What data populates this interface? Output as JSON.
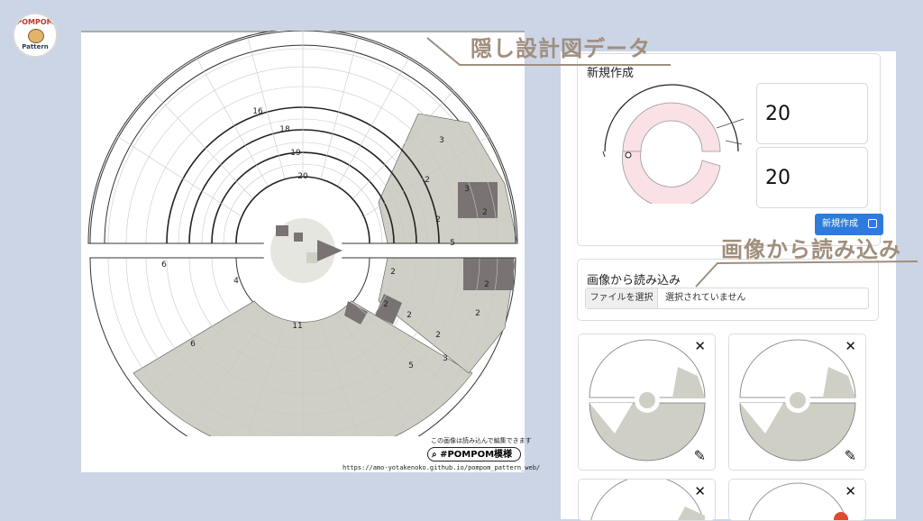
{
  "logo": {
    "top_text": "POMPOM",
    "bottom_text": "Pattern"
  },
  "pattern": {
    "row_labels": [
      "16",
      "18",
      "19",
      "20"
    ],
    "upper_count_labels": [
      "3",
      "2",
      "3",
      "2",
      "2",
      "5"
    ],
    "lower_count_labels": [
      "6",
      "4",
      "6",
      "2",
      "2",
      "2",
      "2",
      "2",
      "11",
      "5",
      "3",
      "2"
    ],
    "caption": "この画像は読み込んで編集できます",
    "hashtag": "#POMPOM模様",
    "url": "https://amo-yotakenoko.github.io/pompom_pattern_web/"
  },
  "callouts": {
    "hidden": "隠し設計図データ",
    "import": "画像から読み込み"
  },
  "new_card": {
    "title": "新規作成",
    "value1": "20",
    "value2": "20",
    "button_label": "新規作成"
  },
  "import_card": {
    "title": "画像から読み込み",
    "file_button": "ファイルを選択",
    "file_status": "選択されていません"
  },
  "thumbnails": {
    "close": "✕",
    "edit": "✎"
  },
  "icons": {
    "search": "search-icon",
    "edit": "pencil-icon",
    "close": "close-icon",
    "logo": "pompom-logo-icon"
  },
  "colors": {
    "background": "#cbd5e6",
    "fill_light": "#cfcfc6",
    "fill_dark": "#7a7373",
    "accent": "#2d7bdc",
    "callout": "#a08e7e",
    "pink": "#f9e1e5"
  }
}
